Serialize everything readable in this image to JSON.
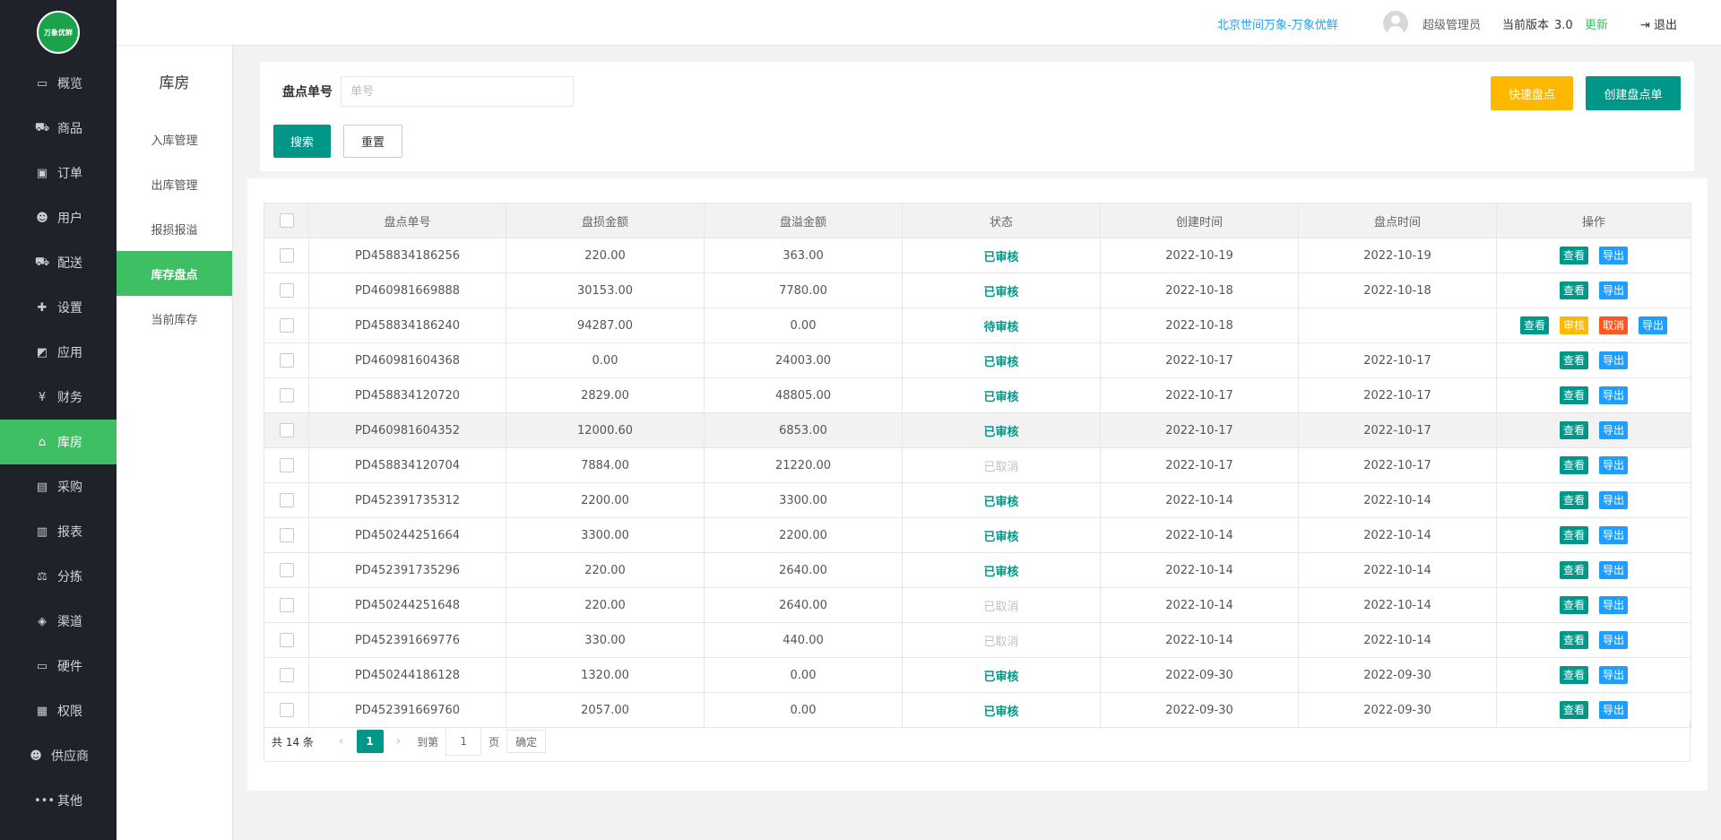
{
  "logo": {
    "text": "万象优鲜"
  },
  "sidebar": {
    "items": [
      {
        "label": "概览",
        "icon": "monitor-icon",
        "glyph": "▭"
      },
      {
        "label": "商品",
        "icon": "cart-icon",
        "glyph": "⛟"
      },
      {
        "label": "订单",
        "icon": "money-icon",
        "glyph": "▣"
      },
      {
        "label": "用户",
        "icon": "users-icon",
        "glyph": "☻"
      },
      {
        "label": "配送",
        "icon": "truck-icon",
        "glyph": "⛟"
      },
      {
        "label": "设置",
        "icon": "puzzle-icon",
        "glyph": "✚"
      },
      {
        "label": "应用",
        "icon": "apps-icon",
        "glyph": "◩"
      },
      {
        "label": "财务",
        "icon": "yen-icon",
        "glyph": "¥"
      },
      {
        "label": "库房",
        "icon": "home-icon",
        "glyph": "⌂"
      },
      {
        "label": "采购",
        "icon": "bus-icon",
        "glyph": "▤"
      },
      {
        "label": "报表",
        "icon": "bar-chart-icon",
        "glyph": "▥"
      },
      {
        "label": "分拣",
        "icon": "scale-icon",
        "glyph": "⚖"
      },
      {
        "label": "渠道",
        "icon": "cube-icon",
        "glyph": "◈"
      },
      {
        "label": "硬件",
        "icon": "desktop-icon",
        "glyph": "▭"
      },
      {
        "label": "权限",
        "icon": "bank-icon",
        "glyph": "▦"
      },
      {
        "label": "供应商",
        "icon": "group-icon",
        "glyph": "☻"
      },
      {
        "label": "其他",
        "icon": "more-icon",
        "glyph": "•••"
      }
    ],
    "active_index": 8
  },
  "header": {
    "company": "北京世间万象-万象优鲜",
    "user": "超级管理员",
    "version_label": "当前版本",
    "version": "3.0",
    "update": "更新",
    "logout": "退出"
  },
  "subnav": {
    "title": "库房",
    "items": [
      "入库管理",
      "出库管理",
      "报损报溢",
      "库存盘点",
      "当前库存"
    ],
    "active_index": 3
  },
  "search": {
    "label": "盘点单号",
    "placeholder": "单号",
    "value": "",
    "search_btn": "搜索",
    "reset_btn": "重置",
    "quick_btn": "快速盘点",
    "create_btn": "创建盘点单"
  },
  "table": {
    "columns": [
      "盘点单号",
      "盘损金额",
      "盘溢金额",
      "状态",
      "创建时间",
      "盘点时间",
      "操作"
    ],
    "action_labels": {
      "view": "查看",
      "export": "导出",
      "audit": "审核",
      "cancel": "取消"
    },
    "rows": [
      {
        "id": "PD458834186256",
        "loss": "220.00",
        "gain": "363.00",
        "status": "已审核",
        "status_type": "ok",
        "created": "2022-10-19",
        "checked": "2022-10-19",
        "actions": [
          "view",
          "export"
        ]
      },
      {
        "id": "PD460981669888",
        "loss": "30153.00",
        "gain": "7780.00",
        "status": "已审核",
        "status_type": "ok",
        "created": "2022-10-18",
        "checked": "2022-10-18",
        "actions": [
          "view",
          "export"
        ]
      },
      {
        "id": "PD458834186240",
        "loss": "94287.00",
        "gain": "0.00",
        "status": "待审核",
        "status_type": "pending",
        "created": "2022-10-18",
        "checked": "",
        "actions": [
          "view",
          "audit",
          "cancel",
          "export"
        ]
      },
      {
        "id": "PD460981604368",
        "loss": "0.00",
        "gain": "24003.00",
        "status": "已审核",
        "status_type": "ok",
        "created": "2022-10-17",
        "checked": "2022-10-17",
        "actions": [
          "view",
          "export"
        ]
      },
      {
        "id": "PD458834120720",
        "loss": "2829.00",
        "gain": "48805.00",
        "status": "已审核",
        "status_type": "ok",
        "created": "2022-10-17",
        "checked": "2022-10-17",
        "actions": [
          "view",
          "export"
        ]
      },
      {
        "id": "PD460981604352",
        "loss": "12000.60",
        "gain": "6853.00",
        "status": "已审核",
        "status_type": "ok",
        "created": "2022-10-17",
        "checked": "2022-10-17",
        "actions": [
          "view",
          "export"
        ],
        "highlight": true
      },
      {
        "id": "PD458834120704",
        "loss": "7884.00",
        "gain": "21220.00",
        "status": "已取消",
        "status_type": "cancel",
        "created": "2022-10-17",
        "checked": "2022-10-17",
        "actions": [
          "view",
          "export"
        ]
      },
      {
        "id": "PD452391735312",
        "loss": "2200.00",
        "gain": "3300.00",
        "status": "已审核",
        "status_type": "ok",
        "created": "2022-10-14",
        "checked": "2022-10-14",
        "actions": [
          "view",
          "export"
        ]
      },
      {
        "id": "PD450244251664",
        "loss": "3300.00",
        "gain": "2200.00",
        "status": "已审核",
        "status_type": "ok",
        "created": "2022-10-14",
        "checked": "2022-10-14",
        "actions": [
          "view",
          "export"
        ]
      },
      {
        "id": "PD452391735296",
        "loss": "220.00",
        "gain": "2640.00",
        "status": "已审核",
        "status_type": "ok",
        "created": "2022-10-14",
        "checked": "2022-10-14",
        "actions": [
          "view",
          "export"
        ]
      },
      {
        "id": "PD450244251648",
        "loss": "220.00",
        "gain": "2640.00",
        "status": "已取消",
        "status_type": "cancel",
        "created": "2022-10-14",
        "checked": "2022-10-14",
        "actions": [
          "view",
          "export"
        ]
      },
      {
        "id": "PD452391669776",
        "loss": "330.00",
        "gain": "440.00",
        "status": "已取消",
        "status_type": "cancel",
        "created": "2022-10-14",
        "checked": "2022-10-14",
        "actions": [
          "view",
          "export"
        ]
      },
      {
        "id": "PD450244186128",
        "loss": "1320.00",
        "gain": "0.00",
        "status": "已审核",
        "status_type": "ok",
        "created": "2022-09-30",
        "checked": "2022-09-30",
        "actions": [
          "view",
          "export"
        ]
      },
      {
        "id": "PD452391669760",
        "loss": "2057.00",
        "gain": "0.00",
        "status": "已审核",
        "status_type": "ok",
        "created": "2022-09-30",
        "checked": "2022-09-30",
        "actions": [
          "view",
          "export"
        ]
      }
    ]
  },
  "pager": {
    "total": "共 14 条",
    "prev": "‹",
    "current": "1",
    "next": "›",
    "goto": "到第",
    "page_input": "1",
    "page": "页",
    "confirm": "确定"
  }
}
